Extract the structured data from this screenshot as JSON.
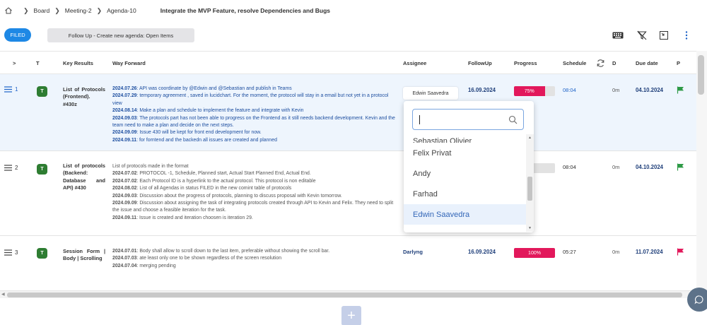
{
  "breadcrumb": {
    "items": [
      "Board",
      "Meeting-2",
      "Agenda-10"
    ],
    "title": "Integrate the MVP Feature, resolve Dependencies and Bugs"
  },
  "toolbar": {
    "filed_label": "FILED",
    "followup_label": "Follow Up - Create new agenda: Open Items",
    "icons": [
      "keyboard-icon",
      "filter-off-icon",
      "collapse-icon",
      "more-vertical-icon"
    ]
  },
  "columns": {
    "expand": ">",
    "t": "T",
    "key_results": "Key Results",
    "way_forward": "Way Forward",
    "assignee": "Assignee",
    "followup": "FollowUp",
    "progress": "Progress",
    "schedule": "Schedule",
    "d": "D",
    "due_date": "Due date",
    "p": "P"
  },
  "rows": [
    {
      "num": "1",
      "type": "T",
      "key_result": "List of Protocols (Frontend). #430z",
      "way_forward": [
        {
          "date": "2024.07.26",
          "text": ":  API was coordinate by @Edwin and @Sebastian and publish in Teams"
        },
        {
          "date": "2024.07.29",
          "text": ":  temporary agreement , saved in lucidchart. For the moment, the protocol will stay in a email but not yet in a protocol view"
        },
        {
          "date": "2024.08.14",
          "text": ":  Make a plan and schedule to implement the feature and integrate with Kevin"
        },
        {
          "date": "2024.09.03",
          "text": ": The protocols part has not been able to progress on the Frontend as it still needs backend development. Kevin and the team need to make a plan and decide on the next steps."
        },
        {
          "date": "2024.09.09",
          "text": ": Issue 430 will be kept for front end development for now."
        },
        {
          "date": "2024.09.11",
          "text": ":  for forntend and the backedn all issues are created and planned"
        }
      ],
      "assignee": "Edwin Saavedra",
      "followup": "16.09.2024",
      "progress_label": "75%",
      "progress": 75,
      "schedule": "08:04",
      "d": "0m",
      "due": "04.10.2024",
      "flag_color": "#2e9a46"
    },
    {
      "num": "2",
      "type": "T",
      "key_result": "List of protocols (Backend: Database and API) #430",
      "way_forward": [
        {
          "date": "",
          "text": "List of protocols made in the format"
        },
        {
          "date": "2024.07.02",
          "text": ":  PROTOCOL -1, Schedule, Planned start, Actual Start Planned End, Actual End."
        },
        {
          "date": "2024.07.02",
          "text": ":  Each Protocol ID is a hyperlink to the actual protocol. This protocol is non editable"
        },
        {
          "date": "2024.08.02",
          "text": ":  List of all Agendas in status FILED in the new comint table of protocols"
        },
        {
          "date": "2024.09.03",
          "text": ": Discussion about the progress of protocols, planning to discuss proposal with Kevin tomorrow."
        },
        {
          "date": "2024.09.09",
          "text": ": Discussion about assigning the task of integrating protocols created through API to Kevin and Felix. They need to split the issue and choose a feasible iteration for the task."
        },
        {
          "date": "2024.09.11",
          "text": ":  Issue is created and iteration choosen is iteration 29."
        }
      ],
      "assignee": "",
      "followup": "",
      "progress_label": "",
      "progress": 0,
      "schedule": "08:04",
      "d": "0m",
      "due": "04.10.2024",
      "flag_color": "#2e9a46"
    },
    {
      "num": "3",
      "type": "T",
      "key_result": "Session Form | Body | Scrolling",
      "way_forward": [
        {
          "date": "2024.07.01",
          "text": ":  Body shall allow to scroll down to the last item, preferable without showing the scroll bar."
        },
        {
          "date": "2024.07.03",
          "text": ":  ate least only one to be shown regardless of the screen resolution"
        },
        {
          "date": "2024.07.04",
          "text": ":  merging pending"
        }
      ],
      "assignee": "Darlyng",
      "followup": "16.09.2024",
      "progress_label": "100%",
      "progress": 100,
      "schedule": "05:27",
      "d": "0m",
      "due": "11.07.2024",
      "flag_color": "#e2185b"
    }
  ],
  "dropdown": {
    "search_value": "",
    "options": [
      "Sebastian Olivier",
      "Felix Privat",
      "Andy",
      "Farhad",
      "Edwin Saavedra"
    ],
    "selected": "Edwin Saavedra"
  },
  "colors": {
    "accent": "#1e88e5",
    "progress_fill": "#e2185b",
    "row_highlight": "#eef5fd",
    "type_badge": "#2e7d32"
  }
}
